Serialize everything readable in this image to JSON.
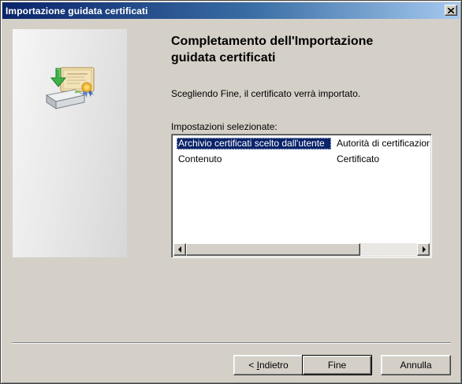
{
  "window": {
    "title": "Importazione guidata certificati",
    "close_icon": "close-icon"
  },
  "banner": {
    "icon": "certificate-import-icon"
  },
  "main": {
    "heading_line1": "Completamento dell'Importazione",
    "heading_line2": "guidata certificati",
    "description": "Scegliendo Fine, il certificato verrà importato.",
    "settings_label": "Impostazioni selezionate:"
  },
  "settings_list": {
    "rows": [
      {
        "setting": "Archivio certificati scelto dall'utente",
        "value": "Autorità di certificazione"
      },
      {
        "setting": "Contenuto",
        "value": "Certificato"
      }
    ],
    "selected_row": 0
  },
  "buttons": {
    "back_prefix": "< ",
    "back_accel": "I",
    "back_rest": "ndietro",
    "finish": "Fine",
    "cancel": "Annulla"
  },
  "colors": {
    "title_bar_start": "#0a246a",
    "title_bar_end": "#a6caf0",
    "dialog_face": "#d4d0c8",
    "selection": "#0a246a"
  }
}
